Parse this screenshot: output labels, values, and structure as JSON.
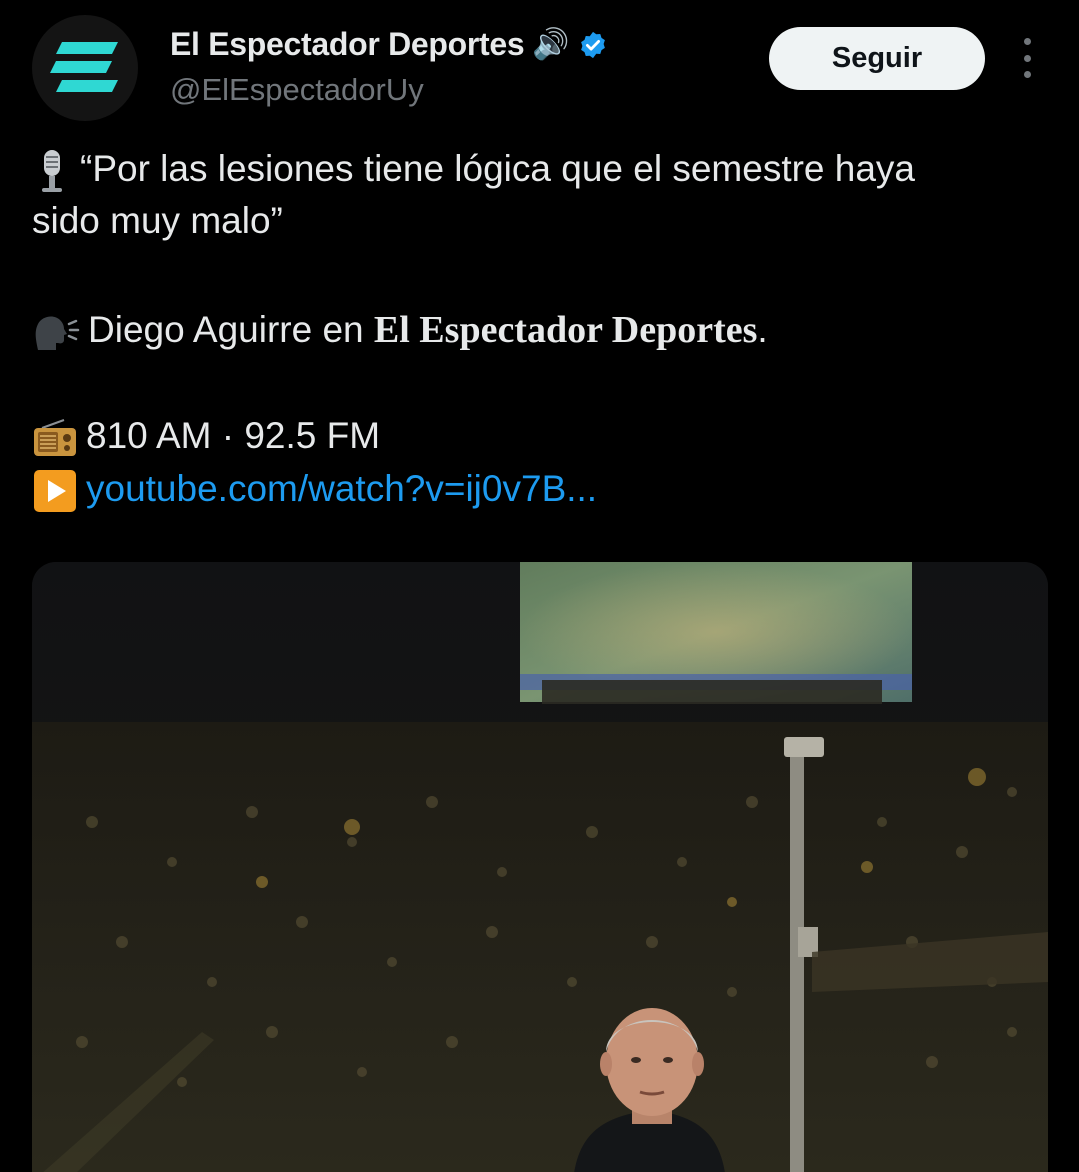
{
  "author": {
    "display_name": "El Espectador Deportes",
    "name_emoji": "🔊",
    "handle": "@ElEspectadorUy",
    "avatar_icon": "ee-logo-icon",
    "accent_color": "#2fd8d3",
    "verified": true,
    "verified_color": "#1d9bf0"
  },
  "actions": {
    "follow_label": "Seguir",
    "more_icon": "more-vertical-icon"
  },
  "tweet": {
    "quote_line1": "“Por las lesiones tiene lógica que el semestre haya",
    "quote_line2": "sido muy malo”",
    "speaker_prefix": "Diego Aguirre en",
    "speaker_show": "El Espectador Deportes",
    "speaker_suffix": ".",
    "radio": "810 AM · 92.5 FM",
    "link": "youtube.com/watch?v=ij0v7B..."
  },
  "icons": {
    "microphone": "microphone-icon",
    "speaking_head": "speaking-head-icon",
    "radio": "radio-icon",
    "play": "play-button-icon"
  },
  "media": {
    "description_icon": "stadium-photo"
  }
}
